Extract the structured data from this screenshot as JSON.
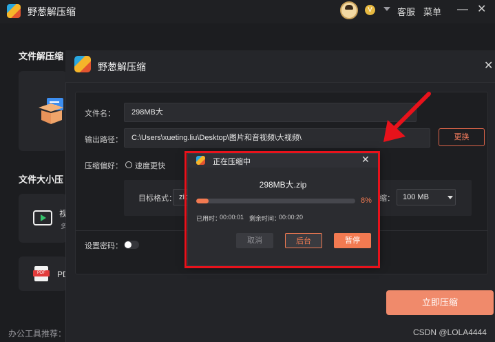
{
  "app": {
    "title": "野葱解压缩"
  },
  "header": {
    "vip_badge": "V",
    "service": "客服",
    "menu": "菜单",
    "minimize": "—",
    "close": "✕"
  },
  "background": {
    "section_decompress": "文件解压缩",
    "section_size_compress": "文件大小压",
    "card_video_label": "视",
    "card_video_sub": "多",
    "card_pdf_label": "PD",
    "card_pdf_icon_text": "PDF",
    "bottom_label": "办公工具推荐："
  },
  "dialog": {
    "title": "野葱解压缩",
    "close": "✕",
    "filename_label": "文件名：",
    "filename_value": "298MB大",
    "output_label": "输出路径：",
    "output_value": "C:\\Users\\xueting.liu\\Desktop\\图片和音视频\\大视频\\",
    "change_button": "更换",
    "preference_label": "压缩偏好：",
    "preference_option": "速度更快",
    "target_format_label": "目标格式：",
    "target_format_value": "zip",
    "size_label": "缩：",
    "size_value": "100 MB",
    "password_label": "设置密码：",
    "compress_button": "立即压缩",
    "password_enabled": false
  },
  "progress": {
    "title": "正在压缩中",
    "close": "✕",
    "file_name": "298MB大.zip",
    "percent": 8,
    "percent_label": "8%",
    "elapsed_label": "已用时：",
    "elapsed_value": "00:00:01",
    "remaining_label": "剩余时间：",
    "remaining_value": "00:00:20",
    "cancel": "取消",
    "background_run": "后台",
    "pause": "暂停"
  },
  "watermark": "CSDN @LOLA4444",
  "colors": {
    "accent": "#f27a51",
    "annotation": "#e8121b"
  }
}
